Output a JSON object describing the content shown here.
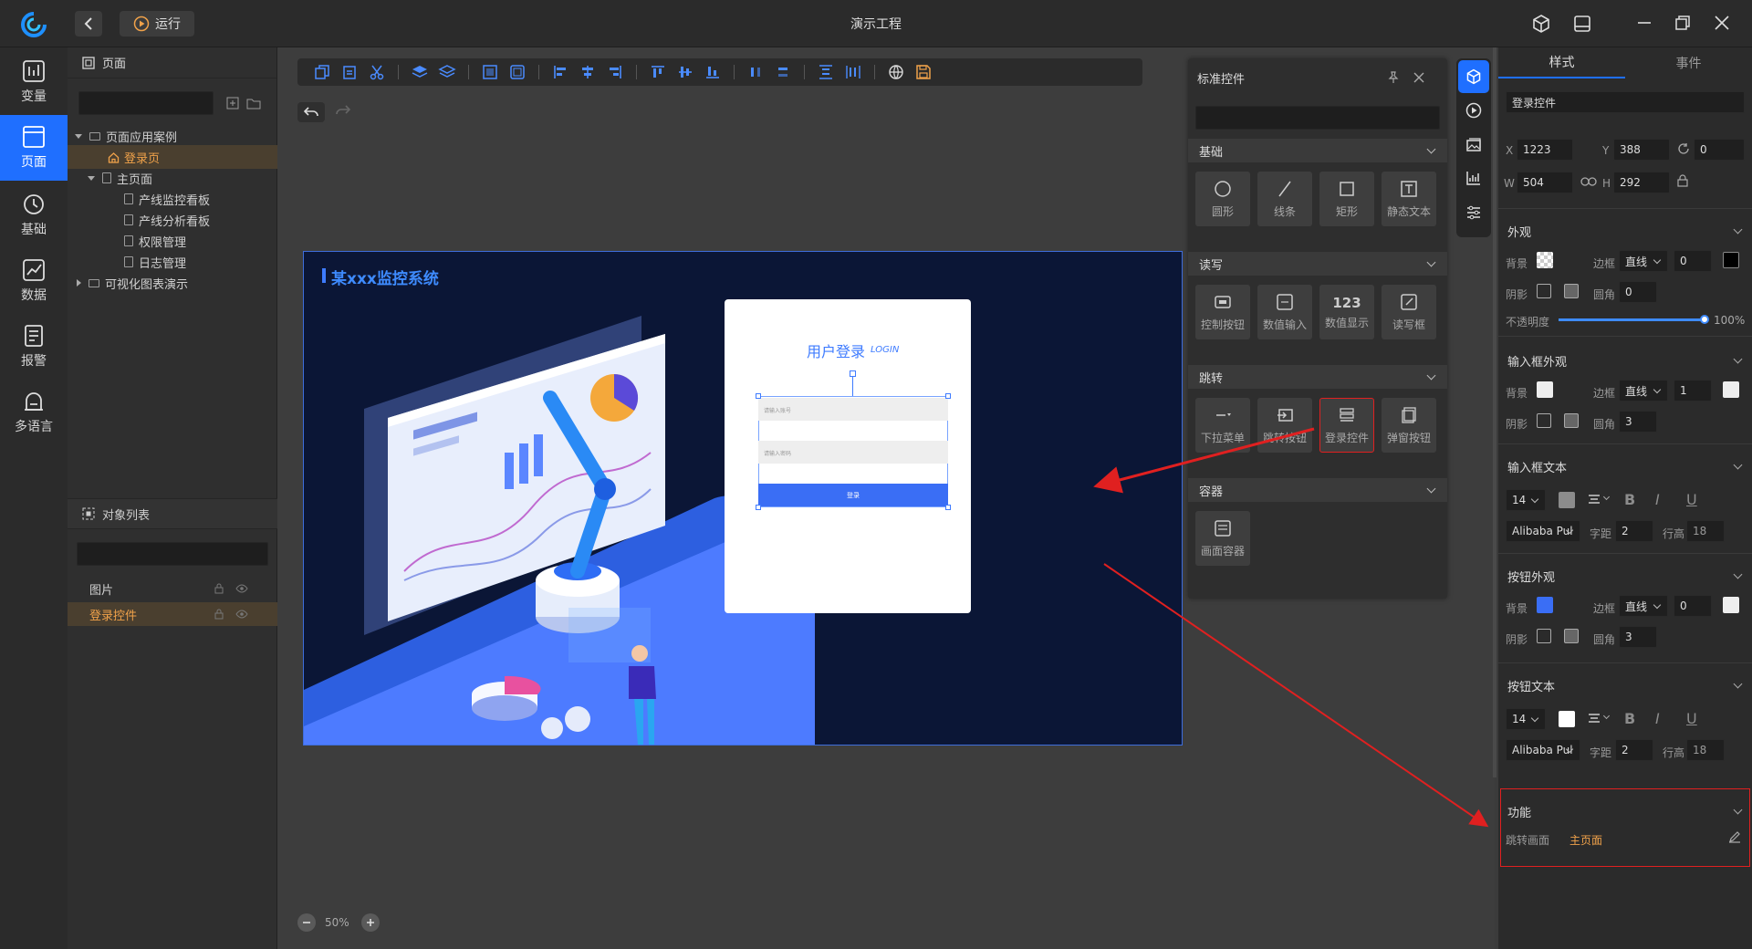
{
  "window": {
    "title": "演示工程",
    "run_label": "运行"
  },
  "nav": {
    "items": [
      {
        "label": "变量",
        "icon": "variable-icon"
      },
      {
        "label": "页面",
        "icon": "page-icon",
        "active": true
      },
      {
        "label": "基础",
        "icon": "history-icon"
      },
      {
        "label": "数据",
        "icon": "data-chart-icon"
      },
      {
        "label": "报警",
        "icon": "alarm-icon"
      },
      {
        "label": "多语言",
        "icon": "language-icon"
      }
    ]
  },
  "pages": {
    "header": "页面",
    "tree": [
      {
        "label": "页面应用案例",
        "type": "folder",
        "open": true
      },
      {
        "label": "登录页",
        "type": "home",
        "selected": true
      },
      {
        "label": "主页面",
        "type": "page",
        "open": true
      },
      {
        "label": "产线监控看板",
        "type": "page"
      },
      {
        "label": "产线分析看板",
        "type": "page"
      },
      {
        "label": "权限管理",
        "type": "page"
      },
      {
        "label": "日志管理",
        "type": "page"
      },
      {
        "label": "可视化图表演示",
        "type": "folder",
        "open": false
      }
    ]
  },
  "objects": {
    "header": "对象列表",
    "items": [
      {
        "label": "图片",
        "selected": false
      },
      {
        "label": "登录控件",
        "selected": true
      }
    ]
  },
  "canvas": {
    "system_title": "某xxx监控系统",
    "login": {
      "title": "用户登录",
      "subtitle": "LOGIN",
      "account_placeholder": "请输入账号",
      "password_placeholder": "请输入密码",
      "button": "登录"
    },
    "zoom": "50%"
  },
  "std": {
    "title": "标准控件",
    "sections": [
      {
        "title": "基础",
        "items": [
          "圆形",
          "线条",
          "矩形",
          "静态文本"
        ]
      },
      {
        "title": "读写",
        "items": [
          "控制按钮",
          "数值输入",
          "数值显示",
          "读写框"
        ]
      },
      {
        "title": "跳转",
        "items": [
          "下拉菜单",
          "跳转按钮",
          "登录控件",
          "弹窗按钮"
        ]
      },
      {
        "title": "容器",
        "items": [
          "画面容器"
        ]
      }
    ],
    "readwrite_numeric_glyph": "123"
  },
  "props": {
    "tabs": [
      "样式",
      "事件"
    ],
    "name": "登录控件",
    "x_label": "X",
    "x": "1223",
    "y_label": "Y",
    "y": "388",
    "rot": "0",
    "w_label": "W",
    "w": "504",
    "h_label": "H",
    "h": "292",
    "appearance": {
      "title": "外观",
      "bg": "背景",
      "border": "边框",
      "border_style": "直线",
      "border_width": "0",
      "shadow": "阴影",
      "radius": "圆角",
      "radius_val": "0",
      "opacity": "不透明度",
      "opacity_val": "100%",
      "opacity_frac": 1.0
    },
    "input_appearance": {
      "title": "输入框外观",
      "bg": "背景",
      "border": "边框",
      "border_style": "直线",
      "border_width": "1",
      "shadow": "阴影",
      "radius": "圆角",
      "radius_val": "3"
    },
    "input_text": {
      "title": "输入框文本",
      "size": "14",
      "font": "Alibaba Pul",
      "spacing_label": "字距",
      "spacing": "2",
      "line_label": "行高",
      "line": "18",
      "color": "#8c8c8c"
    },
    "button_appearance": {
      "title": "按钮外观",
      "bg": "背景",
      "border": "边框",
      "border_style": "直线",
      "border_width": "0",
      "shadow": "阴影",
      "radius": "圆角",
      "radius_val": "3",
      "color": "#3a6ef5"
    },
    "button_text": {
      "title": "按钮文本",
      "size": "14",
      "font": "Alibaba Pul",
      "spacing_label": "字距",
      "spacing": "2",
      "line_label": "行高",
      "line": "18",
      "color": "#ffffff"
    },
    "function": {
      "title": "功能",
      "jump_label": "跳转画面",
      "jump_value": "主页面"
    },
    "fmt": {
      "bold": "B",
      "italic": "I",
      "underline": "U"
    }
  }
}
